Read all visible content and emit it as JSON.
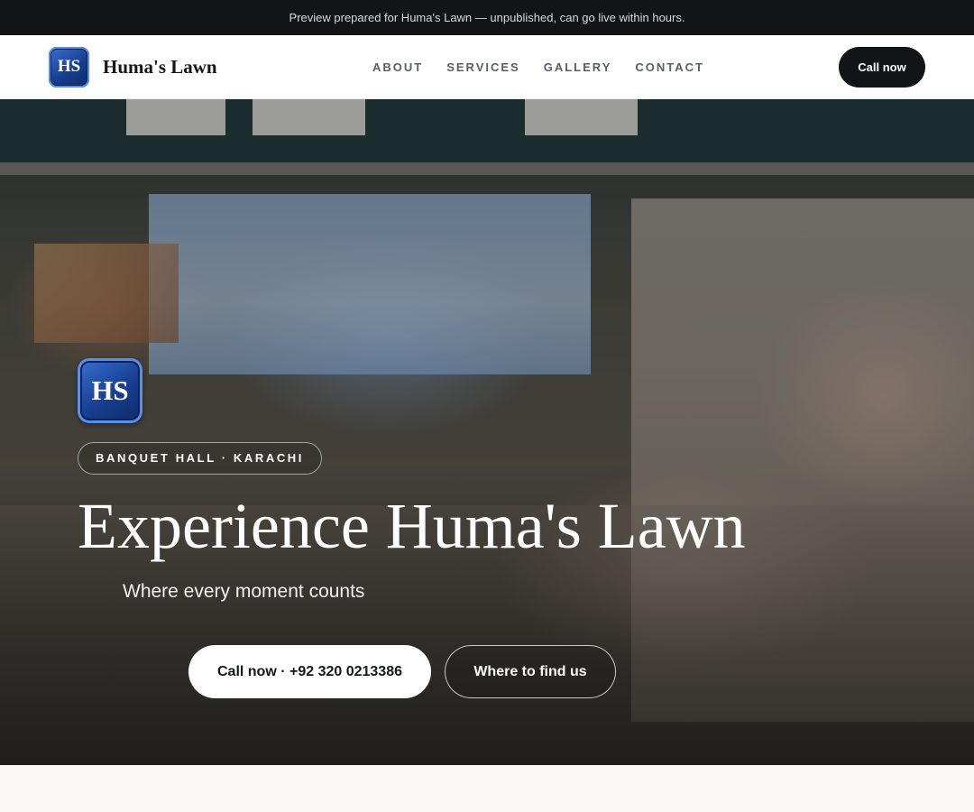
{
  "preview_banner": "Preview prepared for Huma's Lawn — unpublished, can go live within hours.",
  "brand": {
    "logo_text": "HS",
    "name": "Huma's Lawn",
    "logo_gradient": [
      "#3a72d8",
      "#173e90",
      "#0e2a66"
    ]
  },
  "nav": {
    "links": [
      "ABOUT",
      "SERVICES",
      "GALLERY",
      "CONTACT"
    ],
    "cta_label": "Call now"
  },
  "hero": {
    "logo_text": "HS",
    "badge": "BANQUET HALL · KARACHI",
    "title": "Experience Huma's Lawn",
    "subtitle": "Where every moment counts",
    "primary_button": "Call now · +92 320 0213386",
    "secondary_button": "Where to find us"
  },
  "colors": {
    "dark": "#121418",
    "page_background": "#faf9f6",
    "nav_text": "#5a5e66"
  }
}
